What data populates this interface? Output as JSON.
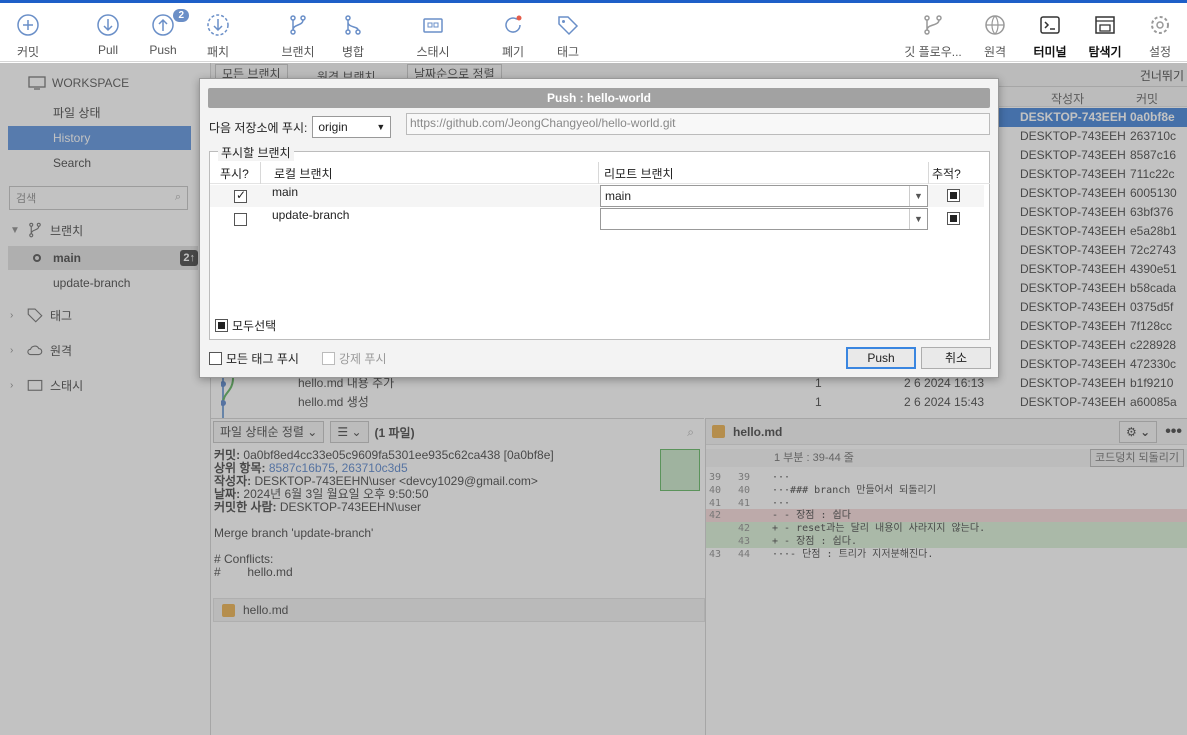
{
  "toolbar": {
    "commit": "커밋",
    "pull": "Pull",
    "push": "Push",
    "push_badge": "2",
    "patch": "패치",
    "branch": "브랜치",
    "merge": "병합",
    "stash": "스태시",
    "discard": "폐기",
    "tag": "태그",
    "gitflow": "깃 플로우...",
    "remote": "원격",
    "terminal": "터미널",
    "explorer": "탐색기",
    "settings": "설정"
  },
  "sidebar": {
    "workspace": "WORKSPACE",
    "items": [
      "파일 상태",
      "History",
      "Search"
    ],
    "search_placeholder": "검색",
    "branches_title": "브랜치",
    "branches": [
      {
        "name": "main",
        "ahead": "2↑"
      },
      {
        "name": "update-branch"
      }
    ],
    "tags_title": "태그",
    "remotes_title": "원격",
    "stashes_title": "스태시"
  },
  "filter": {
    "branches": "모든 브랜치",
    "remote_branches": "원격 브랜치",
    "sort": "날짜순으로 정렬",
    "skip": "건너뛰기"
  },
  "history": {
    "columns": {
      "author": "작성자",
      "commit": "커밋"
    },
    "rows": [
      {
        "author": "DESKTOP-743EEH",
        "commit": "0a0bf8e"
      },
      {
        "author": "DESKTOP-743EEH",
        "commit": "263710c"
      },
      {
        "author": "DESKTOP-743EEH",
        "commit": "8587c16"
      },
      {
        "author": "DESKTOP-743EEH",
        "commit": "711c22c"
      },
      {
        "author": "DESKTOP-743EEH",
        "commit": "6005130"
      },
      {
        "author": "DESKTOP-743EEH",
        "commit": "63bf376"
      },
      {
        "author": "DESKTOP-743EEH",
        "commit": "e5a28b1"
      },
      {
        "author": "DESKTOP-743EEH",
        "commit": "72c2743"
      },
      {
        "author": "DESKTOP-743EEH",
        "commit": "4390e51"
      },
      {
        "author": "DESKTOP-743EEH",
        "commit": "b58cada"
      },
      {
        "author": "DESKTOP-743EEH",
        "commit": "0375d5f"
      },
      {
        "author": "DESKTOP-743EEH",
        "commit": "7f128cc"
      },
      {
        "author": "DESKTOP-743EEH",
        "commit": "c228928"
      },
      {
        "author": "DESKTOP-743EEH",
        "commit": "472330c"
      },
      {
        "desc": "hello.md 내용 추가",
        "count": "1",
        "date": "2 6 2024 16:13",
        "author": "DESKTOP-743EEH",
        "commit": "b1f9210"
      },
      {
        "desc": "hello.md 생성",
        "count": "1",
        "date": "2 6 2024 15:43",
        "author": "DESKTOP-743EEH",
        "commit": "a60085a"
      }
    ]
  },
  "details": {
    "sort": "파일 상태순 정렬",
    "view": "☰",
    "file_count": "(1 파일)",
    "commit_label": "커밋:",
    "commit_value": "0a0bf8ed4cc33e05c9609fa5301ee935c62ca438 [0a0bf8e]",
    "parents_label": "상위 항목:",
    "parent1": "8587c16b75",
    "parent_sep": ", ",
    "parent2": "263710c3d5",
    "author_label": "작성자:",
    "author_value": "DESKTOP-743EEHN\\user <devcy1029@gmail.com>",
    "date_label": "날짜:",
    "date_value": "2024년 6월 3일 월요일 오후 9:50:50",
    "committer_label": "커밋한 사람:",
    "committer_value": "DESKTOP-743EEHN\\user",
    "msg1": "Merge branch 'update-branch'",
    "msg2": "# Conflicts:",
    "msg3": "#        hello.md",
    "file": "hello.md"
  },
  "diff": {
    "file": "hello.md",
    "hunk": "1 부분 : 39-44 줄",
    "revert": "코드덩치 되돌리기",
    "lines": [
      {
        "n1": "39",
        "n2": "39",
        "text": "···",
        "type": "ctx"
      },
      {
        "n1": "40",
        "n2": "40",
        "text": "···### branch 만들어서 되돌리기",
        "type": "ctx"
      },
      {
        "n1": "41",
        "n2": "41",
        "text": "···",
        "type": "ctx"
      },
      {
        "n1": "42",
        "n2": "",
        "text": "- - 장점 : 쉽다",
        "type": "del"
      },
      {
        "n1": "",
        "n2": "42",
        "text": "+ - reset과는 달리 내용이 사라지지 않는다.",
        "type": "add"
      },
      {
        "n1": "",
        "n2": "43",
        "text": "+ - 장점 : 쉽다.",
        "type": "add"
      },
      {
        "n1": "43",
        "n2": "44",
        "text": "···- 단점 : 트리가 지저분해진다.",
        "type": "ctx"
      }
    ]
  },
  "dialog": {
    "title": "Push :  hello-world",
    "remote_label": "다음 저장소에 푸시:",
    "remote_value": "origin",
    "remote_url": "https://github.com/JeongChangyeol/hello-world.git",
    "group_title": "푸시할 브랜치",
    "col_push": "푸시?",
    "col_local": "로컬 브랜치",
    "col_remote": "리모트 브랜치",
    "col_track": "추적?",
    "rows": [
      {
        "local": "main",
        "remote": "main"
      },
      {
        "local": "update-branch",
        "remote": ""
      }
    ],
    "select_all": "모두선택",
    "push_tags": "모든 태그 푸시",
    "force_push": "강제 푸시",
    "push_button": "Push",
    "cancel_button": "취소"
  }
}
